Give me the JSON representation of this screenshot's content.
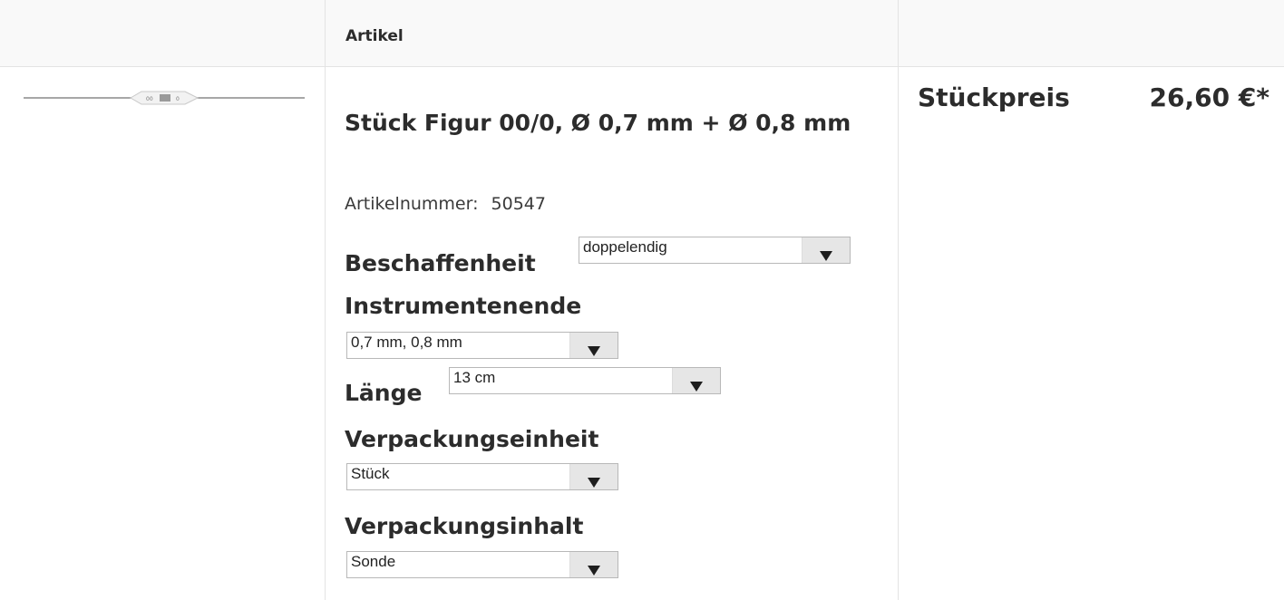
{
  "header": {
    "article_label": "Artikel",
    "price_label": "Stückpreis"
  },
  "product": {
    "title": "Stück Figur 00/0, Ø 0,7 mm + Ø 0,8 mm",
    "article_number_label": "Artikelnummer:",
    "article_number": "50547",
    "price": "26,60 €*",
    "image_marks": [
      "00",
      "0"
    ]
  },
  "options": {
    "beschaffenheit": {
      "label": "Beschaffenheit",
      "value": "doppelendig"
    },
    "instrumentenende": {
      "label": "Instrumentenende",
      "value": "0,7 mm, 0,8 mm"
    },
    "laenge": {
      "label": "Länge",
      "value": "13 cm"
    },
    "verpackungseinheit": {
      "label": "Verpackungseinheit",
      "value": "Stück"
    },
    "verpackungsinhalt": {
      "label": "Verpackungsinhalt",
      "value": "Sonde"
    }
  },
  "icons": {
    "dropdown": "triangle-down-icon"
  }
}
